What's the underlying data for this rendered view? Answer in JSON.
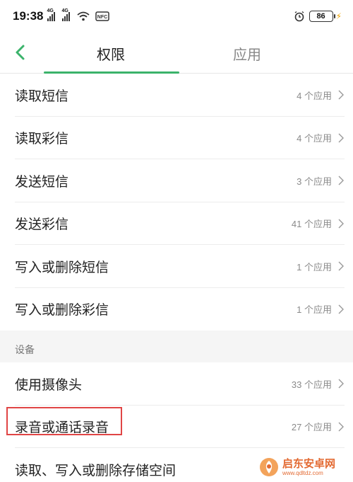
{
  "status_bar": {
    "time": "19:38",
    "signal_1_tag": "4G",
    "signal_2_tag": "4G",
    "nfc_label": "NFC",
    "battery": "86"
  },
  "header": {
    "tabs": [
      {
        "label": "权限",
        "active": true
      },
      {
        "label": "应用",
        "active": false
      }
    ],
    "accent_color": "#3bb36b"
  },
  "permissions": [
    {
      "label": "读取短信",
      "count": "4 个应用"
    },
    {
      "label": "读取彩信",
      "count": "4 个应用"
    },
    {
      "label": "发送短信",
      "count": "3 个应用"
    },
    {
      "label": "发送彩信",
      "count": "41 个应用"
    },
    {
      "label": "写入或删除短信",
      "count": "1 个应用"
    },
    {
      "label": "写入或删除彩信",
      "count": "1 个应用"
    }
  ],
  "device_section": {
    "title": "设备",
    "items": [
      {
        "label": "使用摄像头",
        "count": "33 个应用"
      },
      {
        "label": "录音或通话录音",
        "count": "27 个应用",
        "highlighted": true
      },
      {
        "label": "读取、写入或删除存储空间",
        "count": ""
      }
    ]
  },
  "watermark": {
    "name": "启东安卓网",
    "url": "www.qdltdz.com"
  }
}
